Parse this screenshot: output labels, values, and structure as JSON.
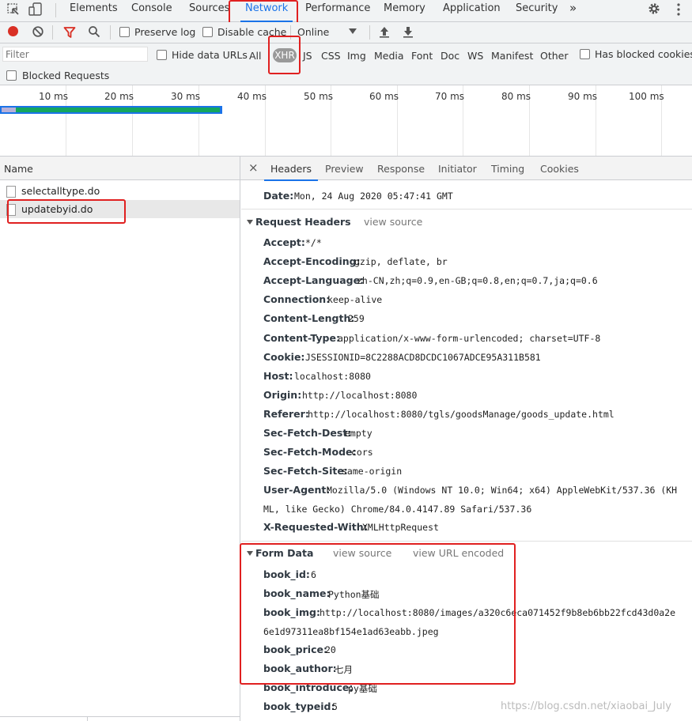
{
  "tabs": [
    "Elements",
    "Console",
    "Sources",
    "Network",
    "Performance",
    "Memory",
    "Application",
    "Security"
  ],
  "tabs_more": "»",
  "toolbar": {
    "preserve_log": "Preserve log",
    "disable_cache": "Disable cache",
    "throttle": "Online"
  },
  "filter": {
    "placeholder": "Filter",
    "hide_data_urls": "Hide data URLs",
    "types": [
      "All",
      "XHR",
      "JS",
      "CSS",
      "Img",
      "Media",
      "Font",
      "Doc",
      "WS",
      "Manifest",
      "Other"
    ],
    "has_blocked_cookies": "Has blocked cookies",
    "blocked_requests": "Blocked Requests"
  },
  "timeline": {
    "ticks": [
      "10 ms",
      "20 ms",
      "30 ms",
      "40 ms",
      "50 ms",
      "60 ms",
      "70 ms",
      "80 ms",
      "90 ms",
      "100 ms"
    ]
  },
  "name_column": "Name",
  "requests": [
    "selectalltype.do",
    "updatebyid.do"
  ],
  "detail_tabs": [
    "Headers",
    "Preview",
    "Response",
    "Initiator",
    "Timing",
    "Cookies"
  ],
  "close_glyph": "×",
  "date": {
    "key": "Date:",
    "value": "Mon, 24 Aug 2020 05:47:41 GMT"
  },
  "request_headers": {
    "title": "Request Headers",
    "view_source": "view source",
    "items": [
      {
        "k": "Accept:",
        "v": "*/*"
      },
      {
        "k": "Accept-Encoding:",
        "v": "gzip, deflate, br"
      },
      {
        "k": "Accept-Language:",
        "v": "zh-CN,zh;q=0.9,en-GB;q=0.8,en;q=0.7,ja;q=0.6"
      },
      {
        "k": "Connection:",
        "v": "keep-alive"
      },
      {
        "k": "Content-Length:",
        "v": "259"
      },
      {
        "k": "Content-Type:",
        "v": "application/x-www-form-urlencoded; charset=UTF-8"
      },
      {
        "k": "Cookie:",
        "v": "JSESSIONID=8C2288ACD8DCDC1067ADCE95A311B581"
      },
      {
        "k": "Host:",
        "v": "localhost:8080"
      },
      {
        "k": "Origin:",
        "v": "http://localhost:8080"
      },
      {
        "k": "Referer:",
        "v": "http://localhost:8080/tgls/goodsManage/goods_update.html"
      },
      {
        "k": "Sec-Fetch-Dest:",
        "v": "empty"
      },
      {
        "k": "Sec-Fetch-Mode:",
        "v": "cors"
      },
      {
        "k": "Sec-Fetch-Site:",
        "v": "same-origin"
      },
      {
        "k": "User-Agent:",
        "v": "Mozilla/5.0 (Windows NT 10.0; Win64; x64) AppleWebKit/537.36 (KH"
      },
      {
        "k": "",
        "v": "ML, like Gecko) Chrome/84.0.4147.89 Safari/537.36"
      },
      {
        "k": "X-Requested-With:",
        "v": "XMLHttpRequest"
      }
    ]
  },
  "form_data": {
    "title": "Form Data",
    "view_source": "view source",
    "view_url_encoded": "view URL encoded",
    "items": [
      {
        "k": "book_id:",
        "v": "6"
      },
      {
        "k": "book_name:",
        "v": "Python基础"
      },
      {
        "k": "book_img:",
        "v": "http://localhost:8080/images/a320c6eca071452f9b8eb6bb22fcd43d0a2e"
      },
      {
        "k": "",
        "v": "6e1d97311ea8bf154e1ad63eabb.jpeg"
      },
      {
        "k": "book_price:",
        "v": "20"
      },
      {
        "k": "book_author:",
        "v": "七月"
      },
      {
        "k": "book_introduce:",
        "v": "py基础"
      },
      {
        "k": "book_typeid:",
        "v": "5"
      }
    ]
  },
  "watermark": "https://blog.csdn.net/xiaobai_July",
  "colors": {
    "accent": "#1a73e8",
    "record": "#d93025",
    "annotation": "#e02020"
  }
}
